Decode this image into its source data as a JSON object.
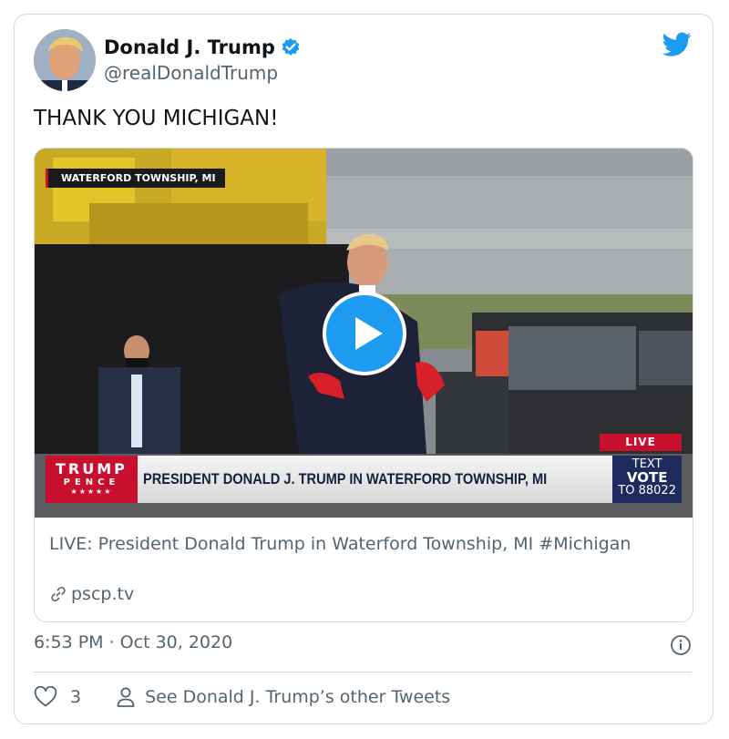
{
  "tweet": {
    "author_name": "Donald J. Trump",
    "author_handle": "@realDonaldTrump",
    "text": "THANK YOU MICHIGAN!",
    "timestamp": "6:53 PM · Oct 30, 2020",
    "like_count": "3",
    "other_tweets_label": "See Donald J. Trump’s other Tweets"
  },
  "media": {
    "location_tag": "WATERFORD TOWNSHIP, MI",
    "logo_line1": "TRUMP",
    "logo_line2": "PENCE",
    "logo_stars": "★★★★★",
    "headline": "PRESIDENT DONALD J. TRUMP IN WATERFORD TOWNSHIP, MI",
    "live_badge": "LIVE",
    "vote_line1": "TEXT",
    "vote_line2": "VOTE",
    "vote_line3": "TO 88022"
  },
  "link_card": {
    "title": "LIVE: President Donald Trump in Waterford Township, MI #Michigan",
    "domain": "pscp.tv"
  },
  "colors": {
    "twitter_blue": "#1d9bf0",
    "muted_text": "#536471",
    "border": "#cfd9de",
    "banner_red": "#c8102e",
    "banner_navy": "#1f2b5e"
  },
  "icons": [
    "twitter-bird-icon",
    "verified-badge-icon",
    "play-icon",
    "link-icon",
    "info-icon",
    "heart-icon",
    "person-icon"
  ]
}
